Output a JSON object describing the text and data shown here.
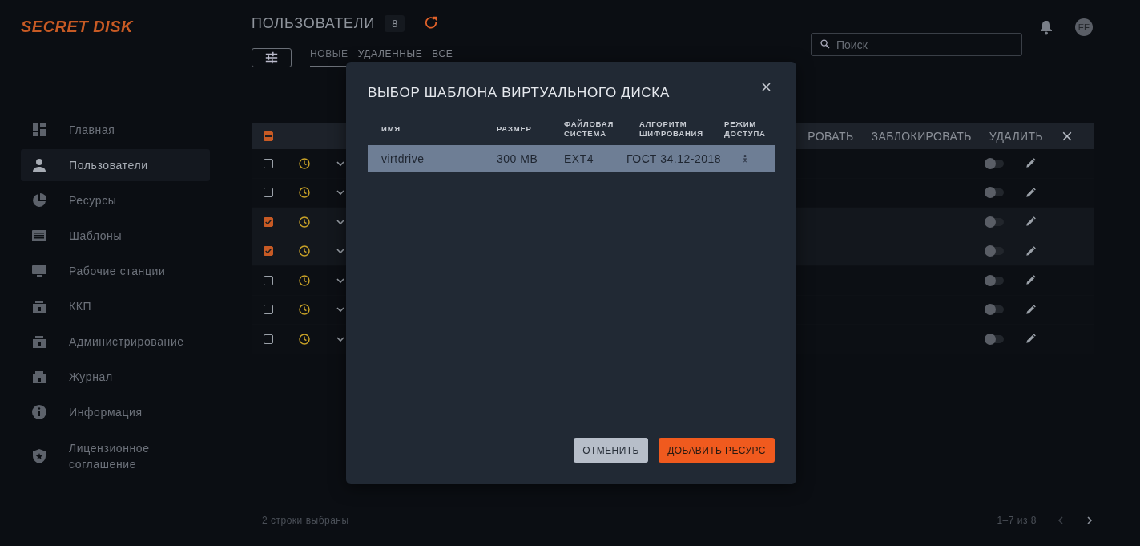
{
  "logo": "SECRET DISK",
  "nav": [
    {
      "label": "Главная",
      "kind": "dashboard",
      "selected": false
    },
    {
      "label": "Пользователи",
      "kind": "person",
      "selected": true
    },
    {
      "label": "Ресурсы",
      "kind": "pie",
      "selected": false
    },
    {
      "label": "Шаблоны",
      "kind": "list",
      "selected": false
    },
    {
      "label": "Рабочие станции",
      "kind": "monitor",
      "selected": false
    },
    {
      "label": "ККП",
      "kind": "lock",
      "selected": false
    },
    {
      "label": "Администрирование",
      "kind": "lock",
      "selected": false
    },
    {
      "label": "Журнал",
      "kind": "lock",
      "selected": false
    },
    {
      "label": "Информация",
      "kind": "info",
      "selected": false
    },
    {
      "label": "Лицензионное соглашение",
      "kind": "shield",
      "selected": false
    }
  ],
  "header": {
    "title": "ПОЛЬЗОВАТЕЛИ",
    "count": "8",
    "search": {
      "placeholder": "Поиск"
    },
    "avatar": "EE"
  },
  "tabs": [
    {
      "label": "НОВЫЕ",
      "selected": true
    },
    {
      "label": "УДАЛЕННЫЕ",
      "selected": false
    },
    {
      "label": "ВСЕ",
      "selected": false
    }
  ],
  "selection_bar": {
    "indeterminate": true,
    "actions": [
      "РОВАТЬ",
      "ЗАБЛОКИРОВАТЬ",
      "УДАЛИТЬ"
    ]
  },
  "rows": [
    {
      "checked": false,
      "on": false
    },
    {
      "checked": false,
      "on": false
    },
    {
      "checked": true,
      "on": false
    },
    {
      "checked": true,
      "on": false
    },
    {
      "checked": false,
      "on": false
    },
    {
      "checked": false,
      "on": false
    },
    {
      "checked": false,
      "on": false
    }
  ],
  "footer": {
    "selected_text": "2 строки выбраны",
    "range": "1–7 из 8"
  },
  "dialog": {
    "title": "ВЫБОР ШАБЛОНА ВИРТУАЛЬНОГО ДИСКА",
    "columns": [
      "ИМЯ",
      "РАЗМЕР",
      "ФАЙЛОВАЯ СИСТЕМА",
      "АЛГОРИТМ ШИФРОВАНИЯ",
      "РЕЖИМ ДОСТУПА"
    ],
    "rows": [
      {
        "cells": [
          "virtdrive",
          "300 MB",
          "EXT4",
          "ГОСТ 34.12-2018"
        ],
        "selected": true
      }
    ],
    "buttons": [
      {
        "label": "ОТМЕНИТЬ",
        "kind": "secondary"
      },
      {
        "label": "ДОБАВИТЬ РЕСУРС",
        "kind": "primary"
      }
    ]
  }
}
